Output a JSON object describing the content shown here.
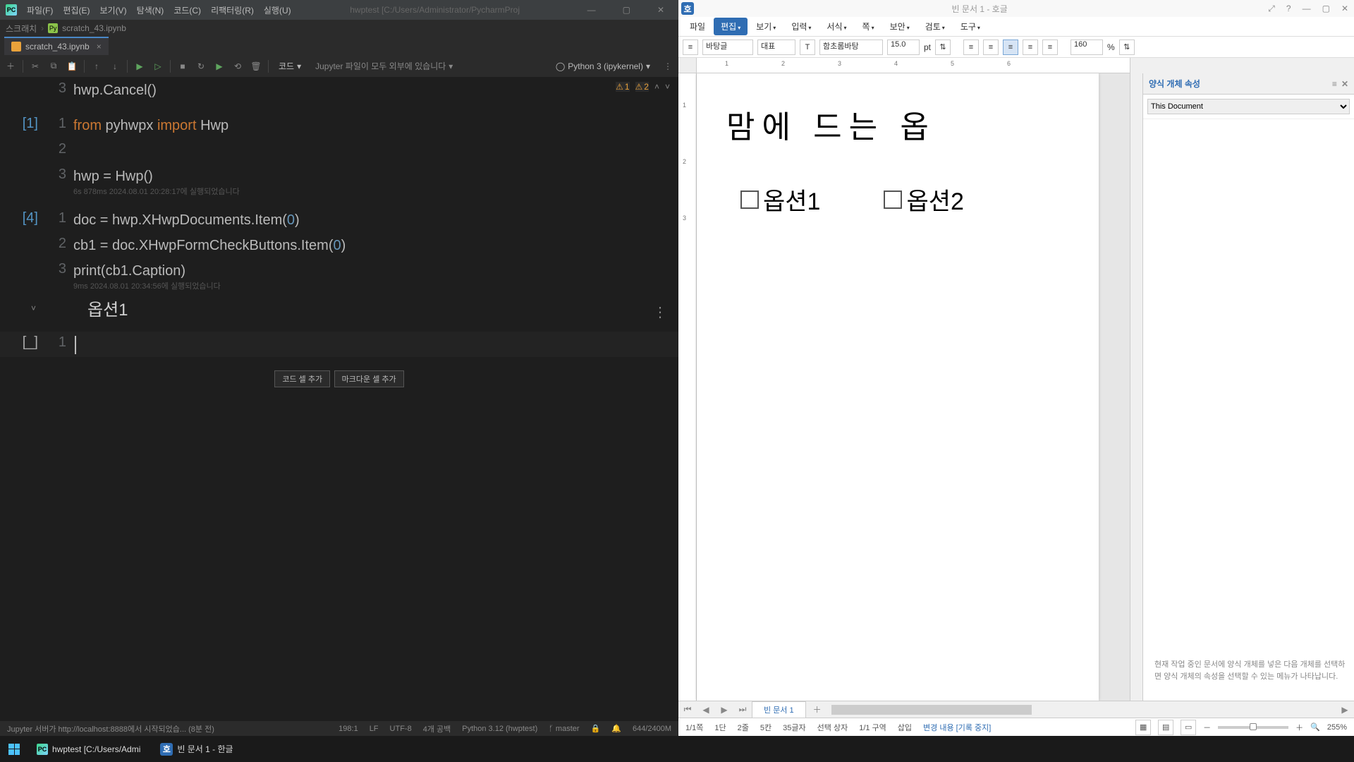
{
  "pycharm": {
    "menus": [
      "파일(F)",
      "편집(E)",
      "보기(V)",
      "탐색(N)",
      "코드(C)",
      "리팩터링(R)",
      "실행(U)"
    ],
    "title_center": "hwptest [C:/Users/Administrator/PycharmProj",
    "crumbs": {
      "root": "스크래치",
      "file": "scratch_43.ipynb"
    },
    "tab": "scratch_43.ipynb",
    "toolbar": {
      "code_label": "코드",
      "jupyter_hint": "Jupyter 파일이 모두 외부에 있습니다",
      "kernel": "Python 3 (ipykernel)"
    },
    "warnings": {
      "w": "1",
      "e": "2"
    },
    "cells": {
      "c0": {
        "lines": {
          "3": "hwp.Cancel()"
        }
      },
      "c1": {
        "prompt": "[1]",
        "lines": {
          "1": "from pyhwpx import Hwp",
          "2": "",
          "3": "hwp = Hwp()"
        },
        "exec": "6s 878ms 2024.08.01 20:28:17에 실행되었습니다"
      },
      "c4": {
        "prompt": "[4]",
        "lines": {
          "1": "doc = hwp.XHwpDocuments.Item(0)",
          "2": "cb1 = doc.XHwpFormCheckButtons.Item(0)",
          "3": "print(cb1.Caption)"
        },
        "exec": "9ms 2024.08.01 20:34:56에 실행되었습니다",
        "output": "옵션1"
      },
      "blank": {
        "prompt": "[_]"
      }
    },
    "add_buttons": {
      "code": "코드 셀 추가",
      "md": "마크다운 셀 추가"
    },
    "status": {
      "server": "Jupyter 서버가 http://localhost:8888에서 시작되었습... (8분 전)",
      "pos": "198:1",
      "eol": "LF",
      "enc": "UTF-8",
      "indent": "4개 공백",
      "python": "Python 3.12 (hwptest)",
      "branch": "master",
      "mem": "644/2400M"
    }
  },
  "hangul": {
    "title": "빈 문서 1 - 호글",
    "menus": [
      "파일",
      "편집",
      "보기",
      "입력",
      "서식",
      "쪽",
      "보안",
      "검토",
      "도구"
    ],
    "format": {
      "style": "바탕글",
      "para": "대표",
      "font": "함초롬바탕",
      "size": "15.0",
      "unit": "pt",
      "zoom": "160",
      "zoom_unit": "%"
    },
    "doc": {
      "heading": "맘에 드는 옵",
      "options": [
        "옵션1",
        "옵션2"
      ]
    },
    "sidepanel": {
      "title": "양식 개체 속성",
      "selector": "This Document",
      "hint": "현재 작업 중인 문서에 양식 개체를 넣은 다음 개체를 선택하면 양식 개체의 속성을 선택할 수 있는 메뉴가 나타납니다."
    },
    "doctab": "빈 문서 1",
    "status": {
      "page": "1/1쪽",
      "dan": "1단",
      "line": "2줄",
      "col": "5칸",
      "chars": "35글자",
      "sel": "선택 상자",
      "sec": "1/1 구역",
      "mode": "삽입",
      "change": "변경 내용 [기록 중지]",
      "zoom": "255%"
    }
  },
  "taskbar": {
    "app1": "hwptest [C:/Users/Admi",
    "app2": "빈 문서 1 - 한글"
  }
}
